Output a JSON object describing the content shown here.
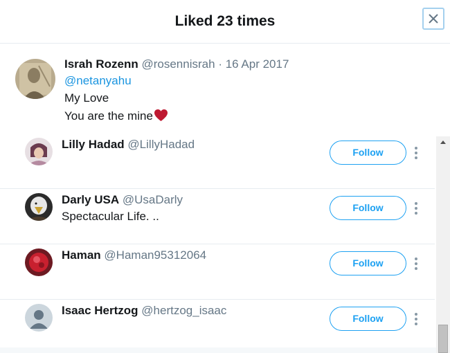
{
  "header": {
    "title": "Liked 23 times",
    "close_label": "Close"
  },
  "tweet": {
    "author_name": "Israh Rozenn",
    "author_handle": "@rosennisrah",
    "separator": "·",
    "date": "16 Apr 2017",
    "mention": "@netanyahu",
    "text_line1": "My Love",
    "text_line2": "You are the mine",
    "emoji": "heart-icon"
  },
  "users": [
    {
      "name": "Lilly Hadad",
      "handle": "@LillyHadad",
      "bio": "",
      "follow_label": "Follow"
    },
    {
      "name": "Darly USA",
      "handle": "@UsaDarly",
      "bio": "Spectacular Life. ..",
      "follow_label": "Follow"
    },
    {
      "name": "Haman",
      "handle": "@Haman95312064",
      "bio": "",
      "follow_label": "Follow"
    },
    {
      "name": "Isaac Hertzog",
      "handle": "@hertzog_isaac",
      "bio": "",
      "follow_label": "Follow"
    }
  ],
  "colors": {
    "accent": "#1da1f2",
    "mention": "#1b95e0",
    "heart": "#e0245e"
  }
}
